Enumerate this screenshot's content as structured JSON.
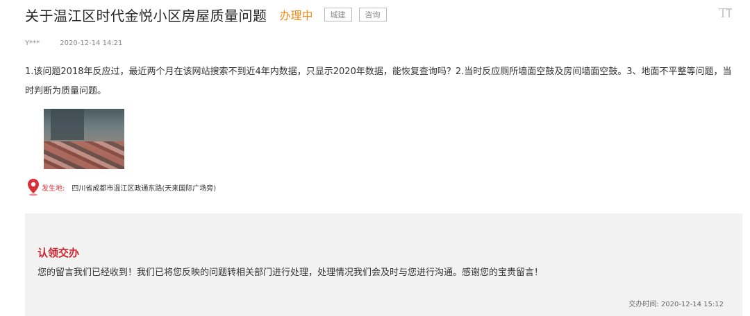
{
  "header": {
    "title": "关于温江区时代金悦小区房屋质量问题",
    "status": "办理中",
    "tags": [
      "城建",
      "咨询"
    ]
  },
  "meta": {
    "user": "Y***",
    "time": "2020-12-14 14:21"
  },
  "content": {
    "text": "1.该问题2018年反应过，最近两个月在该网站搜索不到近4年内数据，只显示2020年数据，能恢复查询吗？2.当时反应厕所墙面空鼓及房间墙面空鼓。3、地面不平整等问题，当时判断为质量问题。"
  },
  "location": {
    "label": "发生地:",
    "value": "四川省成都市温江区政通东路(天来国际广场旁)"
  },
  "reply": {
    "title": "认领交办",
    "text": "您的留言我们已经收到！我们已将您反映的问题转相关部门进行处理，处理情况我们会及时与您进行沟通。感谢您的宝贵留言！",
    "time": "交办时间: 2020-12-14 15:12"
  },
  "colors": {
    "status": "#f08c1a",
    "accent": "#d0252f",
    "reply_bg": "#f2f2f2"
  },
  "icons": [
    "font-size-icon",
    "location-pin-icon"
  ]
}
